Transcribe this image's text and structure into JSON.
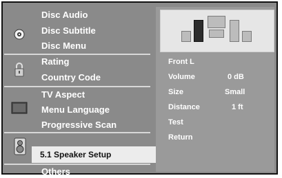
{
  "menu": {
    "disc_audio": "Disc Audio",
    "disc_subtitle": "Disc Subtitle",
    "disc_menu": "Disc Menu",
    "rating": "Rating",
    "country_code": "Country Code",
    "tv_aspect": "TV Aspect",
    "menu_language": "Menu Language",
    "progressive_scan": "Progressive Scan",
    "speaker_setup": "5.1 Speaker Setup",
    "others": "Others"
  },
  "icons": {
    "disc_group": "disc-icon",
    "lock_group": "lock-icon",
    "tv_group": "tv-icon",
    "speaker_group": "speaker-icon"
  },
  "speaker_setup": {
    "channel": "Front L",
    "volume_label": "Volume",
    "volume_value": "0 dB",
    "size_label": "Size",
    "size_value": "Small",
    "distance_label": "Distance",
    "distance_value": "1 ft",
    "test_label": "Test",
    "return_label": "Return"
  }
}
